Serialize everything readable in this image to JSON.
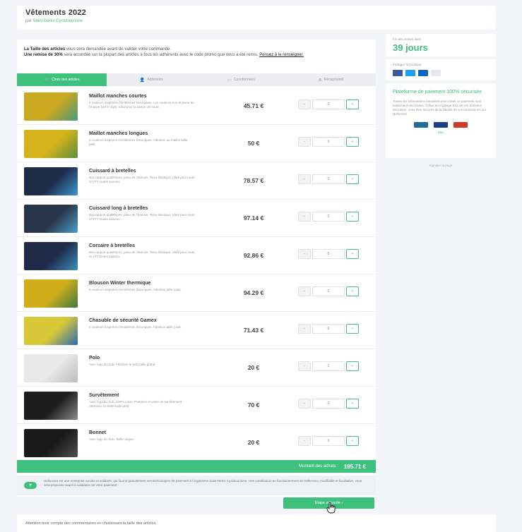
{
  "header": {
    "title": "Vêtements 2022",
    "by_prefix": "par ",
    "org": "Saint-Denis Cyclotourisme"
  },
  "intro": {
    "line1_bold": "La Taille des articles",
    "line1": " vous sera demandée avant de valider votre commande.",
    "line2_bold": "Une remise de 30%",
    "line2": " sera accordée sur la plupart des articles à tous les adhérents avec le code promo que vous a été remis. ",
    "link": "Pensez à le renseigner."
  },
  "tabs": [
    {
      "label": "Choix des articles",
      "icon": "cart-icon",
      "active": true
    },
    {
      "label": "Adhérents",
      "icon": "user-icon",
      "active": false
    },
    {
      "label": "Coordonnées",
      "icon": "id-card-icon",
      "active": false
    },
    {
      "label": "Récapitulatif",
      "icon": "list-icon",
      "active": false
    }
  ],
  "items": [
    {
      "name": "Maillot manches courtes",
      "desc": "6 couleurs inspirées d'emblèmes historiques. Les couleurs noir et jaune de l'équipe font le style. Idéal pour la saison de route.",
      "price": "45.71 €",
      "qty": "0",
      "colors": [
        "#caa820",
        "#4a9a7a"
      ]
    },
    {
      "name": "Maillot manches longues",
      "desc": "6 couleurs inspirées d'emblèmes historiques. Attention au maillot taille petit.",
      "price": "50 €",
      "qty": "0",
      "colors": [
        "#d4b21c",
        "#5a8f3e"
      ]
    },
    {
      "name": "Cuissard à bretelles",
      "desc": "Bon rapport qualité/prix, peau de chamois. Tissu élastique. Idéal pour route et VTT toutes saisons.",
      "price": "78.57 €",
      "qty": "0",
      "colors": [
        "#1e2c4a",
        "#3a9ad0"
      ]
    },
    {
      "name": "Cuissard long à bretelles",
      "desc": "Bon rapport qualité/prix, peau de chamois. Tissu élastique. Idéal pour route et VTT toutes saisons.",
      "price": "97.14 €",
      "qty": "0",
      "colors": [
        "#283449",
        "#4aa0c8"
      ]
    },
    {
      "name": "Corsaire à bretelles",
      "desc": "Bon rapport qualité/prix, peau de chamois. Tissu élastique. Idéal pour route et VTT toutes saisons.",
      "price": "92.86 €",
      "qty": "0",
      "colors": [
        "#1e2a48",
        "#3c8fc0"
      ]
    },
    {
      "name": "Blouson Winter thermique",
      "desc": "6 couleurs inspirées d'emblèmes historiques. Attention taille juste.",
      "price": "94.29 €",
      "qty": "0",
      "colors": [
        "#d0ae1a",
        "#3e7a3e"
      ]
    },
    {
      "name": "Chasuble de sécurité Gamex",
      "desc": "6 couleurs inspirées d'emblèmes historiques. Attention taille juste.",
      "price": "71.43 €",
      "qty": "0",
      "colors": [
        "#d8c838",
        "#2a6ab0"
      ]
    },
    {
      "name": "Polo",
      "desc": "Avec logo du club. Attention le polo taille grand.",
      "price": "20 €",
      "qty": "0",
      "colors": [
        "#e8e8e8",
        "#bcbcbc"
      ]
    },
    {
      "name": "Survêtement",
      "desc": "Avec logo du club. 100% coton. Pantalon et veste de survêtement. Attention, la veste taille petit.",
      "price": "70 €",
      "qty": "0",
      "colors": [
        "#1c1c1c",
        "#8a8a8a"
      ]
    },
    {
      "name": "Bonnet",
      "desc": "Avec logo du club. Taille unique.",
      "price": "20 €",
      "qty": "0",
      "colors": [
        "#1a1a1a",
        "#505050"
      ]
    }
  ],
  "total": {
    "label": "Montant des achats :",
    "value": "195.71 €"
  },
  "notice": "HelloAsso est une entreprise sociale et solidaire, qui fournit gratuitement ses technologies de paiement à l'organisme Saint-Denis Cyclotourisme. Une contribution au fonctionnement de HelloAsso, modifiable et facultative, vous sera proposée avant la validation de votre paiement.",
  "next_button": "Étape suivante  ›",
  "bottom_note": "Attention tenir compte des commentaires en choisissant la taille des articles.",
  "sidebar": {
    "end_label": "Fin des ventes dans",
    "end_value": "39 jours",
    "share_label": "Partager la boutique",
    "share_icons": [
      "facebook-icon",
      "twitter-icon",
      "linkedin-icon",
      "link-icon"
    ],
    "pay_title": "Plateforme de paiement 100% sécurisée",
    "pay_text": "Toutes les informations bancaires pour traiter ce paiement sont totalement sécurisées. Grâce au cryptage SSL de vos données bancaires, vous êtes assurés de la fiabilité de vos transactions sur HelloAsso.",
    "cards": [
      "cb-icon",
      "visa-icon",
      "mastercard-icon"
    ],
    "secure": "SSL",
    "report": "Signaler la page"
  },
  "colors": {
    "accent": "#3ec17d"
  }
}
